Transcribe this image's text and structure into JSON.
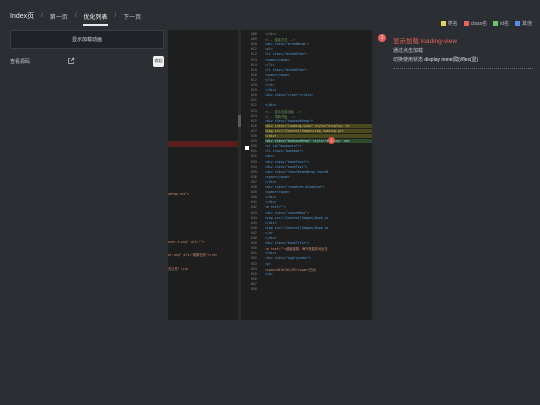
{
  "breadcrumb": {
    "home": "Index页",
    "items": [
      {
        "label": "第一页",
        "active": false
      },
      {
        "label": "优化列表",
        "active": true
      },
      {
        "label": "下一页",
        "active": false
      }
    ]
  },
  "legend": [
    {
      "label": "类名",
      "color": "#e8d35a"
    },
    {
      "label": "class名",
      "color": "#e8615a"
    },
    {
      "label": "id名",
      "color": "#6bc46b"
    },
    {
      "label": "其他",
      "color": "#5a8de8"
    }
  ],
  "left_panel": {
    "title": "显示加载动画",
    "link_label": "查看源码",
    "link_icon": "external-link-icon",
    "toggle_label": "收起"
  },
  "code": {
    "left_snippets": [
      {
        "text": "odrap.css\">",
        "color": "#ce9178"
      },
      {
        "text": "over-t.png\" alt=\"\">",
        "color": "#ce9178"
      },
      {
        "text": "er.png\" alt=\"客服在线\"></a>",
        "color": "#ce9178"
      },
      {
        "text": "关注号？</a>",
        "color": "#ce9178"
      }
    ],
    "line_numbers": [
      "608",
      "609",
      "610",
      "611",
      "612",
      "613",
      "614",
      "615",
      "616",
      "617",
      "618",
      "619",
      "620",
      "621",
      "622",
      "623",
      "624",
      "625",
      "626",
      "627",
      "628",
      "629",
      "630",
      "631",
      "632",
      "633",
      "634",
      "635",
      "636",
      "637",
      "638",
      "639",
      "640",
      "641",
      "642",
      "643",
      "644",
      "645",
      "646",
      "647",
      "648",
      "649",
      "650",
      "651",
      "652",
      "653",
      "654",
      "655",
      "656",
      "657",
      "658"
    ],
    "rows": [
      {
        "text": "  </div>",
        "color": "#808080"
      },
      {
        "text": "  <!-- 结束方式 -->",
        "color": "#6a9955"
      },
      {
        "text": "  <div class=\"breadWrap\">",
        "color": "#569cd6"
      },
      {
        "text": "    <ul>",
        "color": "#569cd6"
      },
      {
        "text": "      <li class=\"breadItem\">",
        "color": "#569cd6"
      },
      {
        "text": "        <span></span>",
        "color": "#569cd6"
      },
      {
        "text": "      </li>",
        "color": "#569cd6"
      },
      {
        "text": "      <li class=\"breadItem\">",
        "color": "#569cd6"
      },
      {
        "text": "        <span></span>",
        "color": "#569cd6"
      },
      {
        "text": "      </li>",
        "color": "#569cd6"
      },
      {
        "text": "    </ul>",
        "color": "#569cd6"
      },
      {
        "text": "  </div>",
        "color": "#569cd6"
      },
      {
        "text": "  <div class=\"clear\"></div>",
        "color": "#569cd6"
      },
      {
        "text": "",
        "color": "#569cd6"
      },
      {
        "text": "</div>",
        "color": "#569cd6"
      },
      {
        "text": "<!-- 显示出载动画 -->",
        "color": "#6a9955"
      },
      {
        "text": "<!-- 重新开始 -->",
        "color": "#6a9955"
      },
      {
        "text": "<div class=\"bookoutWrap\">",
        "color": "#569cd6"
      },
      {
        "text": "  <div class=\"loading-view\" style=\"display: fo",
        "color": "#d7ba7d"
      },
      {
        "text": "    <img src=\"/Content/Images/img_loading.gif",
        "color": "#d7ba7d"
      },
      {
        "text": "  </div>",
        "color": "#d7ba7d"
      },
      {
        "text": "  <div class=\"bookoutWrap\" style=\"display: non",
        "color": "#9cdcfe"
      },
      {
        "text": "    <ul id=\"bookoutul\">",
        "color": "#569cd6"
      },
      {
        "text": "      <li class=\"bookbox\">",
        "color": "#569cd6"
      },
      {
        "text": "        <div>",
        "color": "#569cd6"
      },
      {
        "text": "          <div class=\"bookCover\">",
        "color": "#569cd6"
      },
      {
        "text": "            <div class=\"bookTest\">",
        "color": "#569cd6"
      },
      {
        "text": "              <div class=\"favorBrandWrap favorN",
        "color": "#569cd6"
      },
      {
        "text": "                <span></span>",
        "color": "#569cd6"
      },
      {
        "text": "              </div>",
        "color": "#569cd6"
      },
      {
        "text": "              <div class=\"readArea disabled\">",
        "color": "#569cd6"
      },
      {
        "text": "                <span></span>",
        "color": "#569cd6"
      },
      {
        "text": "              </div>",
        "color": "#569cd6"
      },
      {
        "text": "            </div>",
        "color": "#569cd6"
      },
      {
        "text": "            <a href=\"\">",
        "color": "#569cd6"
      },
      {
        "text": "              <div class=\"coverMask\">",
        "color": "#569cd6"
      },
      {
        "text": "                <img src=\"/Content/Images/book_co",
        "color": "#569cd6"
      },
      {
        "text": "              </div>",
        "color": "#569cd6"
      },
      {
        "text": "              <img src=\"/Content/Images/book_co",
        "color": "#569cd6"
      },
      {
        "text": "            </a>",
        "color": "#569cd6"
      },
      {
        "text": "          </div>",
        "color": "#569cd6"
      },
      {
        "text": "          <div class=\"bookTitle\">",
        "color": "#569cd6"
      },
      {
        "text": "            <a href=\"\">超级英雄：海汽慧能的对反击",
        "color": "#ce9178"
      },
      {
        "text": "          </div>",
        "color": "#569cd6"
      },
      {
        "text": "          <div class=\"applyindex\">",
        "color": "#569cd6"
      },
      {
        "text": "            <p>",
        "color": "#569cd6"
      },
      {
        "text": "              <span>2016/05/03</span>已阅",
        "color": "#ce9178"
      },
      {
        "text": "            </p>",
        "color": "#569cd6"
      },
      {
        "text": "",
        "color": "#569cd6"
      },
      {
        "text": "",
        "color": "#569cd6"
      },
      {
        "text": "",
        "color": "#569cd6"
      }
    ],
    "marker_label": "1"
  },
  "note": {
    "badge": "1",
    "title": "显示加载 loading-view",
    "line1": "通过点击加载",
    "line2_prefix": "切换使用状态",
    "line2_value": "display none(隐)/flex(显)"
  }
}
